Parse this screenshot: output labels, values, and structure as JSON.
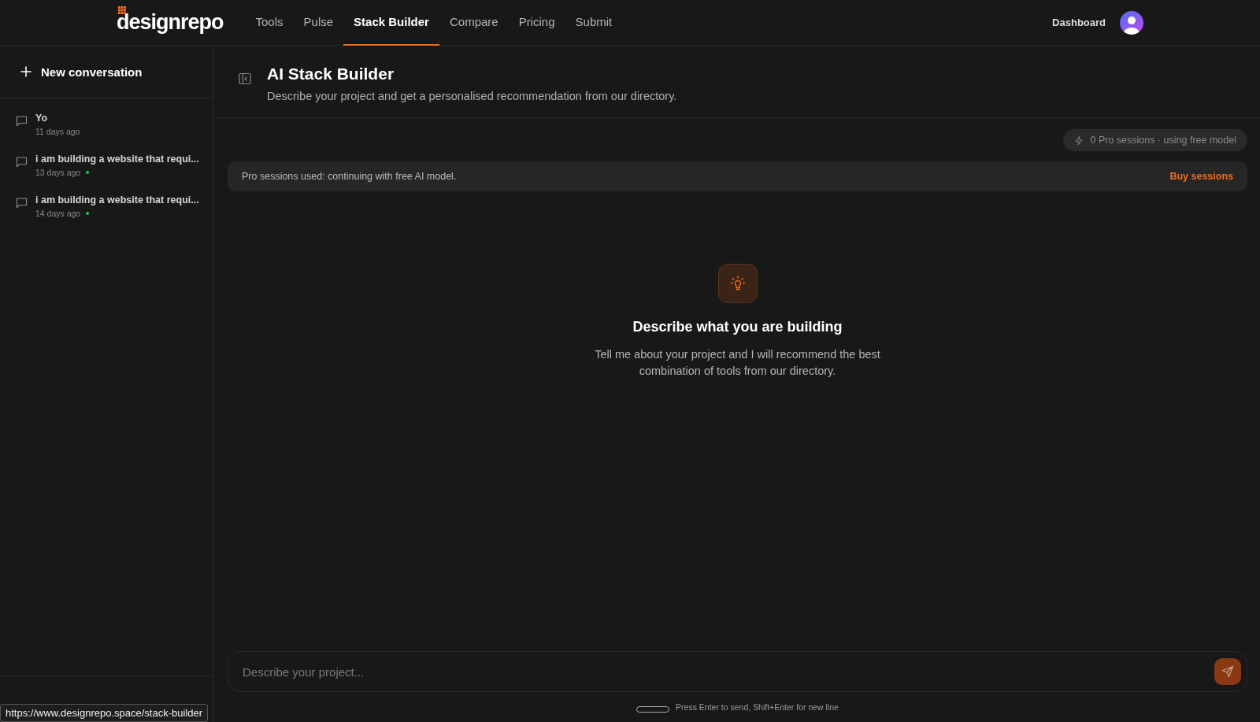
{
  "nav": {
    "logo": "designrepo",
    "links": [
      {
        "label": "Tools",
        "selected": false
      },
      {
        "label": "Pulse",
        "selected": false
      },
      {
        "label": "Stack Builder",
        "selected": true
      },
      {
        "label": "Compare",
        "selected": false
      },
      {
        "label": "Pricing",
        "selected": false
      },
      {
        "label": "Submit",
        "selected": false
      }
    ],
    "dashboard": "Dashboard"
  },
  "sidebar": {
    "new_button": "New conversation",
    "conversations": [
      {
        "title": "Yo",
        "time": "11 days ago",
        "dot": false
      },
      {
        "title": "i am building a website that requi...",
        "time": "13 days ago",
        "dot": true
      },
      {
        "title": "i am building a website that requi...",
        "time": "14 days ago",
        "dot": true
      }
    ]
  },
  "main": {
    "title": "AI Stack Builder",
    "subtitle": "Describe your project and get a personalised recommendation from our directory.",
    "sessions_pill": "0 Pro sessions · using free model",
    "notice": "Pro sessions used: continuing with free AI model.",
    "notice_action": "Buy sessions",
    "empty_title": "Describe what you are building",
    "empty_text": "Tell me about your project and I will recommend the best combination of tools from our directory.",
    "input": {
      "placeholder": "Describe your project..."
    },
    "hint": "Press Enter to send, Shift+Enter for new line"
  },
  "status_url": "https://www.designrepo.space/stack-builder"
}
